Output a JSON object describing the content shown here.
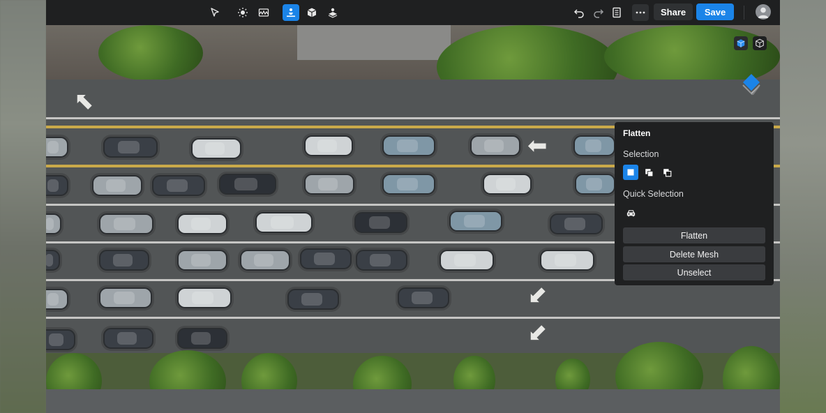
{
  "toolbar": {
    "tools": [
      {
        "name": "select-tool",
        "icon": "cursor-arrow-icon"
      },
      {
        "name": "lighting-tool",
        "icon": "sun-icon"
      },
      {
        "name": "environment-tool",
        "icon": "skyline-icon"
      },
      {
        "name": "flatten-tool",
        "icon": "person-flatten-icon",
        "active": true
      },
      {
        "name": "object-tool",
        "icon": "cube-icon"
      },
      {
        "name": "mesh-tool",
        "icon": "layers-person-icon"
      }
    ],
    "share_label": "Share",
    "save_label": "Save"
  },
  "panel": {
    "title": "Flatten",
    "selection_label": "Selection",
    "quick_selection_label": "Quick Selection",
    "actions": [
      "Flatten",
      "Delete Mesh",
      "Unselect"
    ]
  },
  "colors": {
    "accent": "#1b84e8",
    "toolbar_bg": "#1f2021",
    "panel_bg": "#1f2021",
    "button_bg": "#3a3c3f"
  }
}
